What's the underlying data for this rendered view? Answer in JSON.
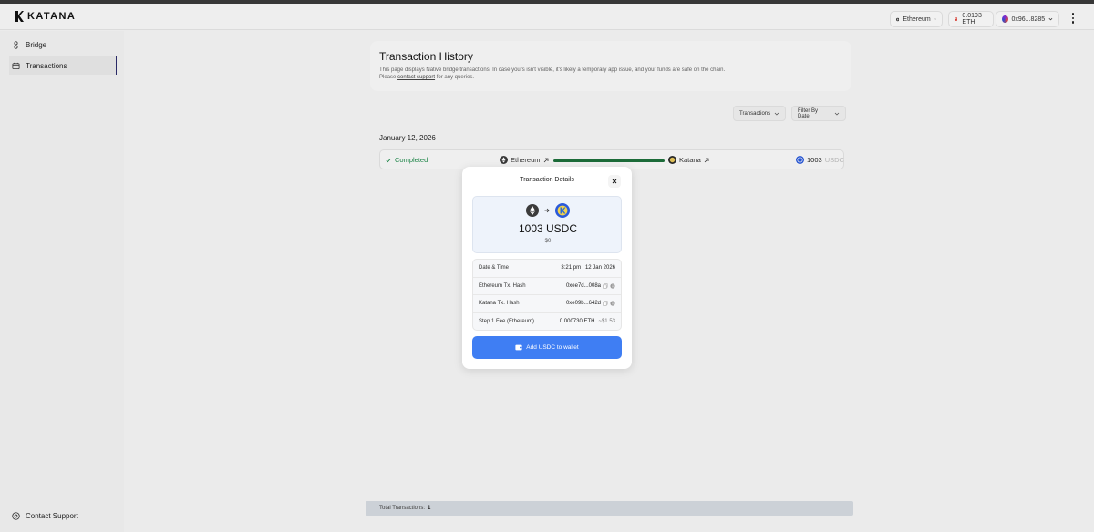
{
  "header": {
    "logo_text": "KATANA",
    "network_label": "Ethereum",
    "balance_label": "0.0193 ETH",
    "account_label": "0x96...8285"
  },
  "sidebar": {
    "items": [
      {
        "label": "Bridge"
      },
      {
        "label": "Transactions"
      }
    ],
    "support_label": "Contact Support"
  },
  "history": {
    "title": "Transaction History",
    "desc_text": "This page displays Native bridge transactions. In case yours isn't visible, it's likely a temporary app issue, and your funds are safe on the chain.",
    "desc_prefix": "Please",
    "desc_link": "contact support",
    "desc_suffix": "for any queries."
  },
  "filters": {
    "transactions_label": "Transactions",
    "date_label": "Filter By Date"
  },
  "tx_list": {
    "date": "January 12, 2026",
    "rows": [
      {
        "status": "Completed",
        "source_chain": "Ethereum",
        "dest_chain": "Katana",
        "progress": 1.0,
        "amount": "1003",
        "unit": "USDC"
      }
    ]
  },
  "footer": {
    "label": "Total Transactions:",
    "count": "1"
  },
  "modal": {
    "title": "Transaction Details",
    "amount": "1003 USDC",
    "usd": "$0",
    "rows": [
      {
        "label": "Date & Time",
        "value": "3:21 pm | 12 Jan 2026"
      },
      {
        "label": "Ethereum Tx. Hash",
        "value": "0xee7d...008a"
      },
      {
        "label": "Katana Tx. Hash",
        "value": "0xe09b...642d"
      },
      {
        "label": "Step 1 Fee (Ethereum)",
        "value": "0.000730 ETH",
        "extra": "~$1.53"
      }
    ],
    "button_label": "Add USDC to wallet"
  },
  "colors": {
    "accent_blue": "#3f7ef3",
    "success_green": "#1e8a4a",
    "progress_green": "#1e6f3c"
  },
  "icons": [
    "katana-logo-icon",
    "ethereum-icon",
    "chevron-down-icon",
    "fuel-icon",
    "avatar-icon",
    "kebab-menu-icon",
    "bridge-icon",
    "transactions-icon",
    "help-icon",
    "check-icon",
    "external-link-icon",
    "katana-chain-icon",
    "usdc-icon",
    "close-icon",
    "arrow-right-icon",
    "copy-icon",
    "info-icon",
    "wallet-icon"
  ]
}
